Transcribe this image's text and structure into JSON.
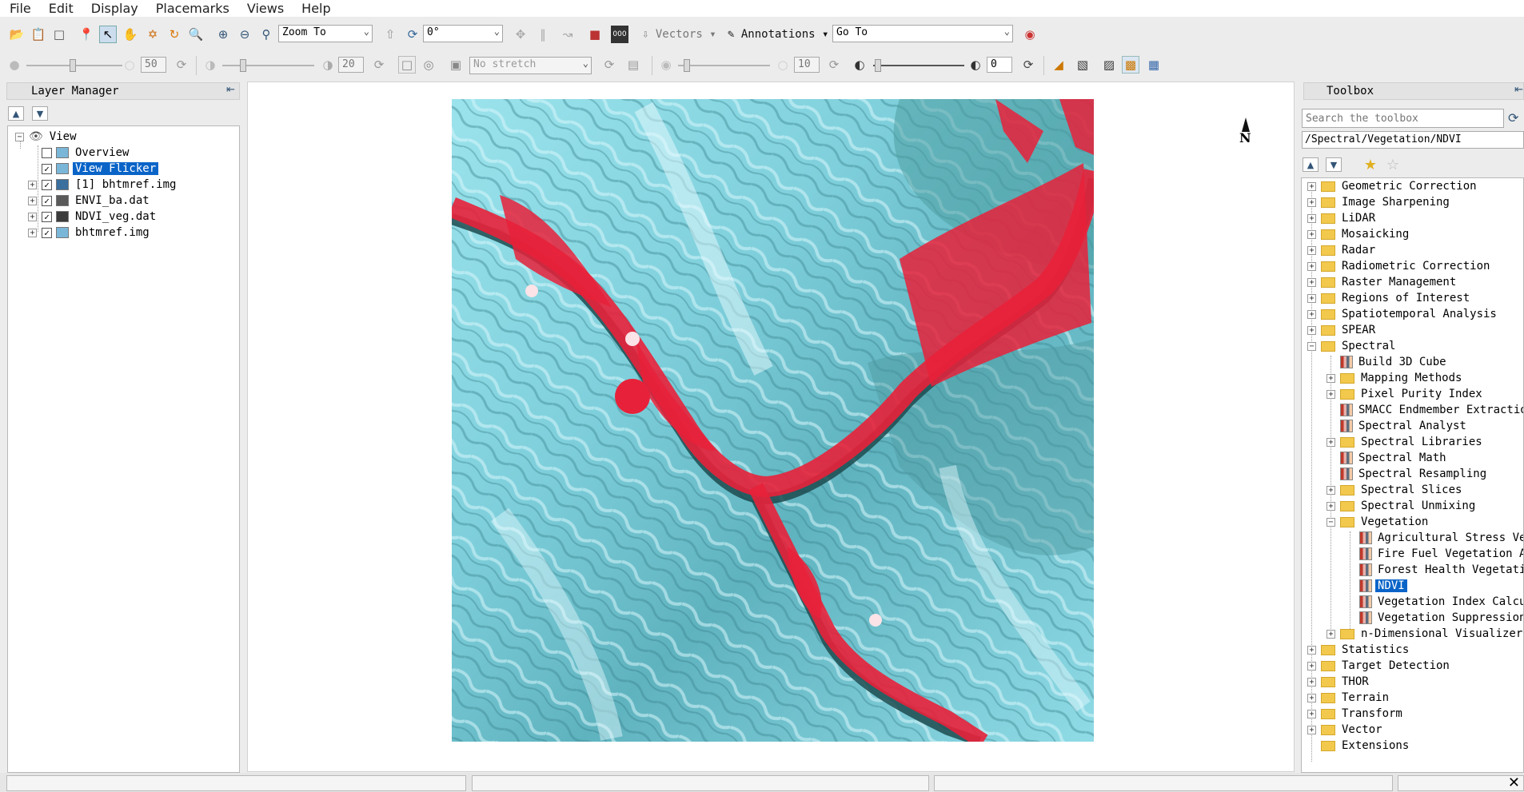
{
  "menu": [
    "File",
    "Edit",
    "Display",
    "Placemarks",
    "Views",
    "Help"
  ],
  "toolbar1": {
    "zoom_combo": "Zoom To",
    "rotation_combo": "0°",
    "vectors_label": "Vectors",
    "annotations_label": "Annotations",
    "goto_combo": "Go To"
  },
  "toolbar2": {
    "brightness_value": "50",
    "contrast_value": "20",
    "stretch_combo": "No stretch",
    "sharpen_value": "10",
    "transparency_value": "0"
  },
  "layer_manager": {
    "title": "Layer Manager",
    "root": "View",
    "items": [
      {
        "label": "Overview",
        "checked": false,
        "expandable": false,
        "selected": false
      },
      {
        "label": "View Flicker",
        "checked": true,
        "expandable": false,
        "selected": true
      },
      {
        "label": "[1] bhtmref.img",
        "checked": true,
        "expandable": true,
        "selected": false
      },
      {
        "label": "ENVI_ba.dat",
        "checked": true,
        "expandable": true,
        "selected": false
      },
      {
        "label": "NDVI_veg.dat",
        "checked": true,
        "expandable": true,
        "selected": false
      },
      {
        "label": "bhtmref.img",
        "checked": true,
        "expandable": true,
        "selected": false
      }
    ]
  },
  "view": {
    "north_label": "N"
  },
  "toolbox": {
    "title": "Toolbox",
    "search_placeholder": "Search the toolbox",
    "path": "/Spectral/Vegetation/NDVI",
    "items": [
      {
        "label": "Geometric Correction",
        "level": 0,
        "type": "folder",
        "state": "collapsed"
      },
      {
        "label": "Image Sharpening",
        "level": 0,
        "type": "folder",
        "state": "collapsed"
      },
      {
        "label": "LiDAR",
        "level": 0,
        "type": "folder",
        "state": "collapsed"
      },
      {
        "label": "Mosaicking",
        "level": 0,
        "type": "folder",
        "state": "collapsed"
      },
      {
        "label": "Radar",
        "level": 0,
        "type": "folder",
        "state": "collapsed"
      },
      {
        "label": "Radiometric Correction",
        "level": 0,
        "type": "folder",
        "state": "collapsed"
      },
      {
        "label": "Raster Management",
        "level": 0,
        "type": "folder",
        "state": "collapsed"
      },
      {
        "label": "Regions of Interest",
        "level": 0,
        "type": "folder",
        "state": "collapsed"
      },
      {
        "label": "Spatiotemporal Analysis",
        "level": 0,
        "type": "folder",
        "state": "collapsed"
      },
      {
        "label": "SPEAR",
        "level": 0,
        "type": "folder",
        "state": "collapsed"
      },
      {
        "label": "Spectral",
        "level": 0,
        "type": "folder",
        "state": "expanded"
      },
      {
        "label": "Build 3D Cube",
        "level": 1,
        "type": "tool",
        "state": ""
      },
      {
        "label": "Mapping Methods",
        "level": 1,
        "type": "folder",
        "state": "collapsed"
      },
      {
        "label": "Pixel Purity Index",
        "level": 1,
        "type": "folder",
        "state": "collapsed"
      },
      {
        "label": "SMACC Endmember Extraction",
        "level": 1,
        "type": "tool",
        "state": ""
      },
      {
        "label": "Spectral Analyst",
        "level": 1,
        "type": "tool",
        "state": ""
      },
      {
        "label": "Spectral Libraries",
        "level": 1,
        "type": "folder",
        "state": "collapsed"
      },
      {
        "label": "Spectral Math",
        "level": 1,
        "type": "tool",
        "state": ""
      },
      {
        "label": "Spectral Resampling",
        "level": 1,
        "type": "tool",
        "state": ""
      },
      {
        "label": "Spectral Slices",
        "level": 1,
        "type": "folder",
        "state": "collapsed"
      },
      {
        "label": "Spectral Unmixing",
        "level": 1,
        "type": "folder",
        "state": "collapsed"
      },
      {
        "label": "Vegetation",
        "level": 1,
        "type": "folder",
        "state": "expanded"
      },
      {
        "label": "Agricultural Stress Ve",
        "level": 2,
        "type": "tool",
        "state": ""
      },
      {
        "label": "Fire Fuel Vegetation A",
        "level": 2,
        "type": "tool",
        "state": ""
      },
      {
        "label": "Forest Health Vegetation",
        "level": 2,
        "type": "tool",
        "state": ""
      },
      {
        "label": "NDVI",
        "level": 2,
        "type": "tool",
        "state": "selected"
      },
      {
        "label": "Vegetation Index Calcula",
        "level": 2,
        "type": "tool",
        "state": ""
      },
      {
        "label": "Vegetation Suppression",
        "level": 2,
        "type": "tool",
        "state": ""
      },
      {
        "label": "n-Dimensional Visualizer",
        "level": 1,
        "type": "folder",
        "state": "collapsed"
      },
      {
        "label": "Statistics",
        "level": 0,
        "type": "folder",
        "state": "collapsed"
      },
      {
        "label": "Target Detection",
        "level": 0,
        "type": "folder",
        "state": "collapsed"
      },
      {
        "label": "THOR",
        "level": 0,
        "type": "folder",
        "state": "collapsed"
      },
      {
        "label": "Terrain",
        "level": 0,
        "type": "folder",
        "state": "collapsed"
      },
      {
        "label": "Transform",
        "level": 0,
        "type": "folder",
        "state": "collapsed"
      },
      {
        "label": "Vector",
        "level": 0,
        "type": "folder",
        "state": "collapsed"
      },
      {
        "label": "Extensions",
        "level": 0,
        "type": "folder",
        "state": "leaf"
      }
    ]
  },
  "colors": {
    "selection": "#0a64c8",
    "vegetation_red": "#e8213a",
    "terrain_cyan": "#7fd3de"
  }
}
